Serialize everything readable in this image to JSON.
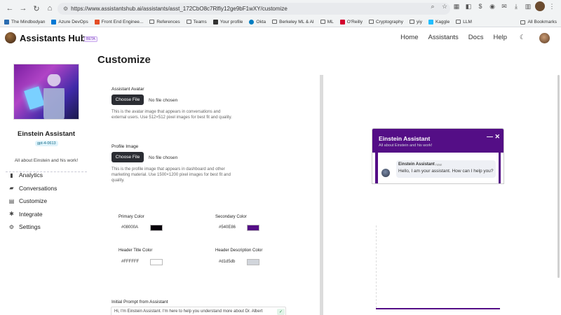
{
  "browser": {
    "url": "https://www.assistantshub.ai/assistants/asst_172CbO8c7Rlfiy12ge9bF1wXY/customize",
    "bookmarks": [
      "The Mindbodyan",
      "Azure DevOps",
      "Front End Enginee...",
      "References",
      "Teams",
      "Your profile",
      "Okta",
      "Berkeley ML & AI",
      "ML",
      "O'Reilly",
      "Cryptography",
      "yiy",
      "Kaggle",
      "LLM"
    ],
    "all_bookmarks": "All Bookmarks"
  },
  "header": {
    "brand": "Assistants Hub",
    "beta": "BETA",
    "nav": [
      "Home",
      "Assistants",
      "Docs",
      "Help"
    ]
  },
  "sidebar": {
    "assistant_name": "Einstein Assistant",
    "model": "gpt-4-0613",
    "description": "All about Einstein and his work!",
    "items": [
      {
        "label": "Analytics",
        "icon": "bar-chart-icon"
      },
      {
        "label": "Conversations",
        "icon": "chat-bubbles-icon"
      },
      {
        "label": "Customize",
        "icon": "document-icon"
      },
      {
        "label": "Integrate",
        "icon": "puzzle-icon"
      },
      {
        "label": "Settings",
        "icon": "gear-icon"
      }
    ]
  },
  "main": {
    "title": "Customize",
    "avatar": {
      "label": "Assistant Avatar",
      "button": "Choose File",
      "status": "No file chosen",
      "help_line1": "This is the avatar image that appears in conversations and",
      "help_line2": "external users. Use 512×512 pixel images for best fit and quality."
    },
    "profile": {
      "label": "Profile Image",
      "button": "Choose File",
      "status": "No file chosen",
      "help_line1": "This is the profile image that appears in dashboard and other",
      "help_line2": "marketing material. Use 1500×1200 pixel images for best fit and",
      "help_line3": "quality."
    },
    "colors": {
      "primary": {
        "label": "Primary Color",
        "value": "#08000A"
      },
      "secondary": {
        "label": "Secondary Color",
        "value": "#540E86"
      },
      "header_title": {
        "label": "Header Title Color",
        "value": "#FFFFFF"
      },
      "header_desc": {
        "label": "Header Description Color",
        "value": "#d1d5db"
      }
    },
    "prompt": {
      "label": "Initial Prompt from Assistant",
      "value": "Hi, I'm Einstein Assistant. I'm here to help you understand more about Dr. Albert"
    }
  },
  "preview": {
    "title": "Einstein Assistant",
    "subtitle": "All about Einstein and his work!",
    "controls": "— ✕",
    "message_author": "Einstein Assistant",
    "message_time": "now",
    "message_text": "Hello, I am your assistant. How can I help you?"
  }
}
